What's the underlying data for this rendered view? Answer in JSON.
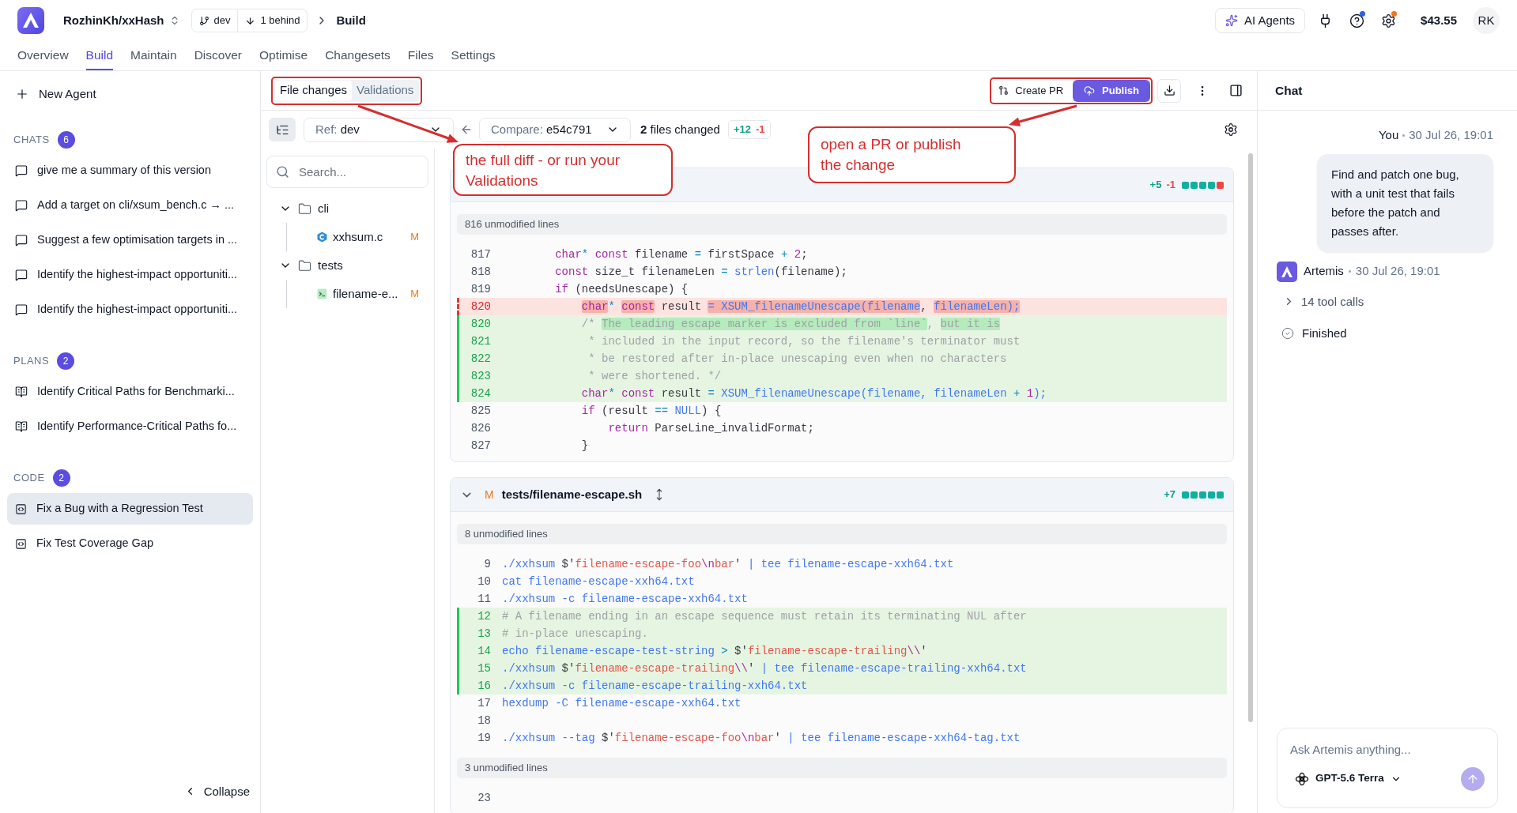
{
  "header": {
    "repo": "RozhinKh/xxHash",
    "branch": "dev",
    "behind": "1 behind",
    "page": "Build",
    "ai_button": "AI Agents",
    "icons": [
      {
        "kind": "plug"
      },
      {
        "kind": "help",
        "color": "#2563eb"
      },
      {
        "kind": "settings",
        "color": "#f97316"
      }
    ],
    "balance": "$43.55",
    "avatar": "RK"
  },
  "nav": [
    {
      "label": "Overview",
      "selected": false
    },
    {
      "label": "Build",
      "selected": true
    },
    {
      "label": "Maintain",
      "selected": false
    },
    {
      "label": "Discover",
      "selected": false
    },
    {
      "label": "Optimise",
      "selected": false
    },
    {
      "label": "Changesets",
      "selected": false
    },
    {
      "label": "Files",
      "selected": false
    },
    {
      "label": "Settings",
      "selected": false
    }
  ],
  "sidebar": {
    "new_agent": "New Agent",
    "sections": [
      {
        "title": "CHATS",
        "count": "6",
        "items": [
          {
            "kind": "chat",
            "label": "give me a summary of this version",
            "selected": false
          },
          {
            "kind": "chat",
            "label": "Add a target on cli/xsum_bench.c → ...",
            "selected": false
          },
          {
            "kind": "chat",
            "label": "Suggest a few optimisation targets in ...",
            "selected": false
          },
          {
            "kind": "chat",
            "label": "Identify the highest-impact opportuniti...",
            "selected": false
          },
          {
            "kind": "chat",
            "label": "Identify the highest-impact opportuniti...",
            "selected": false
          }
        ]
      },
      {
        "title": "PLANS",
        "count": "2",
        "items": [
          {
            "kind": "plan",
            "label": "Identify Critical Paths for Benchmarki...",
            "selected": false
          },
          {
            "kind": "plan",
            "label": "Identify Performance-Critical Paths fo...",
            "selected": false
          }
        ]
      },
      {
        "title": "CODE",
        "count": "2",
        "items": [
          {
            "kind": "code",
            "label": "Fix a Bug with a Regression Test",
            "selected": true
          },
          {
            "kind": "code",
            "label": "Fix Test Coverage Gap",
            "selected": false
          }
        ]
      }
    ],
    "collapse": "Collapse"
  },
  "workspace": {
    "tabs": [
      {
        "label": "File changes",
        "selected": true
      },
      {
        "label": "Validations",
        "selected": false
      }
    ],
    "create_pr": "Create PR",
    "publish": "Publish",
    "ref_label": "Ref:",
    "ref_value": "dev",
    "compare_label": "Compare:",
    "compare_value": "e54c791",
    "files_changed_count": "2",
    "files_changed_text": "files changed",
    "additions": "+12",
    "deletions": "-1",
    "search_placeholder": "Search...",
    "tree": [
      {
        "kind": "folder",
        "name": "cli",
        "expanded": true,
        "children": [
          {
            "kind": "c",
            "name": "xxhsum.c",
            "status": "M"
          }
        ]
      },
      {
        "kind": "folder",
        "name": "tests",
        "expanded": true,
        "children": [
          {
            "kind": "shell",
            "name": "filename-e...",
            "status": "M"
          }
        ]
      }
    ],
    "files": [
      {
        "additions": "+5",
        "deletions": "-1",
        "blocks": [
          {
            "kind": "added"
          },
          {
            "kind": "added"
          },
          {
            "kind": "added"
          },
          {
            "kind": "added"
          },
          {
            "kind": "removed"
          }
        ],
        "rows": [
          {
            "kind": "fold",
            "text": "816 unmodified lines"
          },
          {
            "kind": "context",
            "number": "817",
            "segments": [
              {
                "kind": "kw",
                "text": "        char"
              },
              {
                "kind": "op",
                "text": "* "
              },
              {
                "kind": "kw",
                "text": "const"
              },
              {
                "kind": "plain",
                "text": " filename "
              },
              {
                "kind": "op",
                "text": "= "
              },
              {
                "kind": "plain",
                "text": "firstSpace "
              },
              {
                "kind": "op",
                "text": "+ "
              },
              {
                "kind": "kw",
                "text": "2"
              },
              {
                "kind": "plain",
                "text": ";"
              }
            ]
          },
          {
            "kind": "context",
            "number": "818",
            "segments": [
              {
                "kind": "kw",
                "text": "        const"
              },
              {
                "kind": "plain",
                "text": " size_t filenameLen "
              },
              {
                "kind": "op",
                "text": "= "
              },
              {
                "kind": "fn",
                "text": "strlen"
              },
              {
                "kind": "plain",
                "text": "(filename);"
              }
            ]
          },
          {
            "kind": "context",
            "number": "819",
            "segments": [
              {
                "kind": "kw",
                "text": "        if"
              },
              {
                "kind": "plain",
                "text": " (needsUnescape) {"
              }
            ]
          },
          {
            "kind": "removed",
            "number": "820",
            "segments": [
              {
                "kind": "kw",
                "text": "            char",
                "changed": true
              },
              {
                "kind": "op",
                "text": "* "
              },
              {
                "kind": "kw",
                "text": "const",
                "changed": true
              },
              {
                "kind": "plain",
                "text": " result "
              },
              {
                "kind": "fn",
                "text": "= XSUM_filenameUnescape(filename",
                "changed": true
              },
              {
                "kind": "plain",
                "text": ", "
              },
              {
                "kind": "fn",
                "text": "filenameLen);",
                "changed": true
              }
            ]
          },
          {
            "kind": "added",
            "number": "820",
            "segments": [
              {
                "kind": "cm",
                "text": "            /* "
              },
              {
                "kind": "cm",
                "text": "The leading escape marker is excluded from `line`",
                "changed": true
              },
              {
                "kind": "cm",
                "text": ", "
              },
              {
                "kind": "cm",
                "text": "but it is",
                "changed": true
              }
            ]
          },
          {
            "kind": "added",
            "number": "821",
            "segments": [
              {
                "kind": "cm",
                "text": "             * included in the input record, so the filename's terminator must"
              }
            ]
          },
          {
            "kind": "added",
            "number": "822",
            "segments": [
              {
                "kind": "cm",
                "text": "             * be restored after in-place unescaping even when no characters"
              }
            ]
          },
          {
            "kind": "added",
            "number": "823",
            "segments": [
              {
                "kind": "cm",
                "text": "             * were shortened. */"
              }
            ]
          },
          {
            "kind": "added",
            "number": "824",
            "segments": [
              {
                "kind": "kw",
                "text": "            char"
              },
              {
                "kind": "op",
                "text": "* "
              },
              {
                "kind": "kw",
                "text": "const"
              },
              {
                "kind": "plain",
                "text": " result "
              },
              {
                "kind": "op",
                "text": "= "
              },
              {
                "kind": "fn",
                "text": "XSUM_filenameUnescape(filename, filenameLen "
              },
              {
                "kind": "op",
                "text": "+ "
              },
              {
                "kind": "kw",
                "text": "1"
              },
              {
                "kind": "fn",
                "text": ");"
              }
            ]
          },
          {
            "kind": "context",
            "number": "825",
            "segments": [
              {
                "kind": "kw",
                "text": "            if"
              },
              {
                "kind": "plain",
                "text": " (result "
              },
              {
                "kind": "op",
                "text": "== "
              },
              {
                "kind": "fn",
                "text": "NULL"
              },
              {
                "kind": "plain",
                "text": ") {"
              }
            ]
          },
          {
            "kind": "context",
            "number": "826",
            "segments": [
              {
                "kind": "kw",
                "text": "                return"
              },
              {
                "kind": "plain",
                "text": " ParseLine_invalidFormat;"
              }
            ]
          },
          {
            "kind": "context",
            "number": "827",
            "segments": [
              {
                "kind": "plain",
                "text": "            }"
              }
            ]
          }
        ]
      },
      {
        "status": "M",
        "path": "tests/filename-escape.sh",
        "expanded": true,
        "additions": "+7",
        "blocks": [
          {
            "kind": "added"
          },
          {
            "kind": "added"
          },
          {
            "kind": "added"
          },
          {
            "kind": "added"
          },
          {
            "kind": "added"
          }
        ],
        "rows": [
          {
            "kind": "fold",
            "text": "8 unmodified lines"
          },
          {
            "kind": "context",
            "number": "9",
            "segments": [
              {
                "kind": "fn",
                "text": "./xxhsum"
              },
              {
                "kind": "plain",
                "text": " $'"
              },
              {
                "kind": "str",
                "text": "filename-escape-foo"
              },
              {
                "kind": "kw",
                "text": "\\n"
              },
              {
                "kind": "str",
                "text": "bar"
              },
              {
                "kind": "plain",
                "text": "'"
              },
              {
                "kind": "fn",
                "text": " | tee filename-escape-xxh64.txt"
              }
            ]
          },
          {
            "kind": "context",
            "number": "10",
            "segments": [
              {
                "kind": "fn",
                "text": "cat filename-escape-xxh64.txt"
              }
            ]
          },
          {
            "kind": "context",
            "number": "11",
            "segments": [
              {
                "kind": "fn",
                "text": "./xxhsum -c filename-escape-xxh64.txt"
              }
            ]
          },
          {
            "kind": "added",
            "number": "12",
            "segments": [
              {
                "kind": "cm",
                "text": "# A filename ending in an escape sequence must retain its terminating NUL after"
              }
            ]
          },
          {
            "kind": "added",
            "number": "13",
            "segments": [
              {
                "kind": "cm",
                "text": "# in-place unescaping."
              }
            ]
          },
          {
            "kind": "added",
            "number": "14",
            "segments": [
              {
                "kind": "fn",
                "text": "echo filename-escape-test-string "
              },
              {
                "kind": "op",
                "text": ">"
              },
              {
                "kind": "plain",
                "text": " $'"
              },
              {
                "kind": "str",
                "text": "filename-escape-trailing"
              },
              {
                "kind": "kw",
                "text": "\\\\"
              },
              {
                "kind": "plain",
                "text": "'"
              }
            ]
          },
          {
            "kind": "added",
            "number": "15",
            "segments": [
              {
                "kind": "fn",
                "text": "./xxhsum"
              },
              {
                "kind": "plain",
                "text": " $'"
              },
              {
                "kind": "str",
                "text": "filename-escape-trailing"
              },
              {
                "kind": "kw",
                "text": "\\\\"
              },
              {
                "kind": "plain",
                "text": "'"
              },
              {
                "kind": "fn",
                "text": " | tee filename-escape-trailing-xxh64.txt"
              }
            ]
          },
          {
            "kind": "added",
            "number": "16",
            "segments": [
              {
                "kind": "fn",
                "text": "./xxhsum -c filename-escape-trailing-xxh64.txt"
              }
            ]
          },
          {
            "kind": "context",
            "number": "17",
            "segments": [
              {
                "kind": "fn",
                "text": "hexdump -C filename-escape-xxh64.txt"
              }
            ]
          },
          {
            "kind": "context",
            "number": "18"
          },
          {
            "kind": "context",
            "number": "19",
            "segments": [
              {
                "kind": "fn",
                "text": "./xxhsum --tag"
              },
              {
                "kind": "plain",
                "text": " $'"
              },
              {
                "kind": "str",
                "text": "filename-escape-foo"
              },
              {
                "kind": "kw",
                "text": "\\n"
              },
              {
                "kind": "str",
                "text": "bar"
              },
              {
                "kind": "plain",
                "text": "'"
              },
              {
                "kind": "fn",
                "text": " | tee filename-escape-xxh64-tag.txt"
              }
            ]
          },
          {
            "kind": "fold",
            "text": "3 unmodified lines"
          },
          {
            "kind": "context",
            "number": "23"
          }
        ]
      }
    ]
  },
  "chat": {
    "title": "Chat",
    "messages": [
      {
        "kind": "user",
        "author": "You",
        "time": "30 Jul 26, 19:01",
        "text": "Find and patch one bug, with a unit test that fails before the patch and passes after."
      },
      {
        "kind": "agent",
        "author": "Artemis",
        "time": "30 Jul 26, 19:01",
        "tool_calls": "14 tool calls",
        "status": "Finished"
      }
    ],
    "input_placeholder": "Ask Artemis anything...",
    "model": "GPT-5.6 Terra"
  },
  "annotations": [
    {
      "text": "the full diff - or run your Validations"
    },
    {
      "text": "open a PR or publish the change"
    }
  ]
}
